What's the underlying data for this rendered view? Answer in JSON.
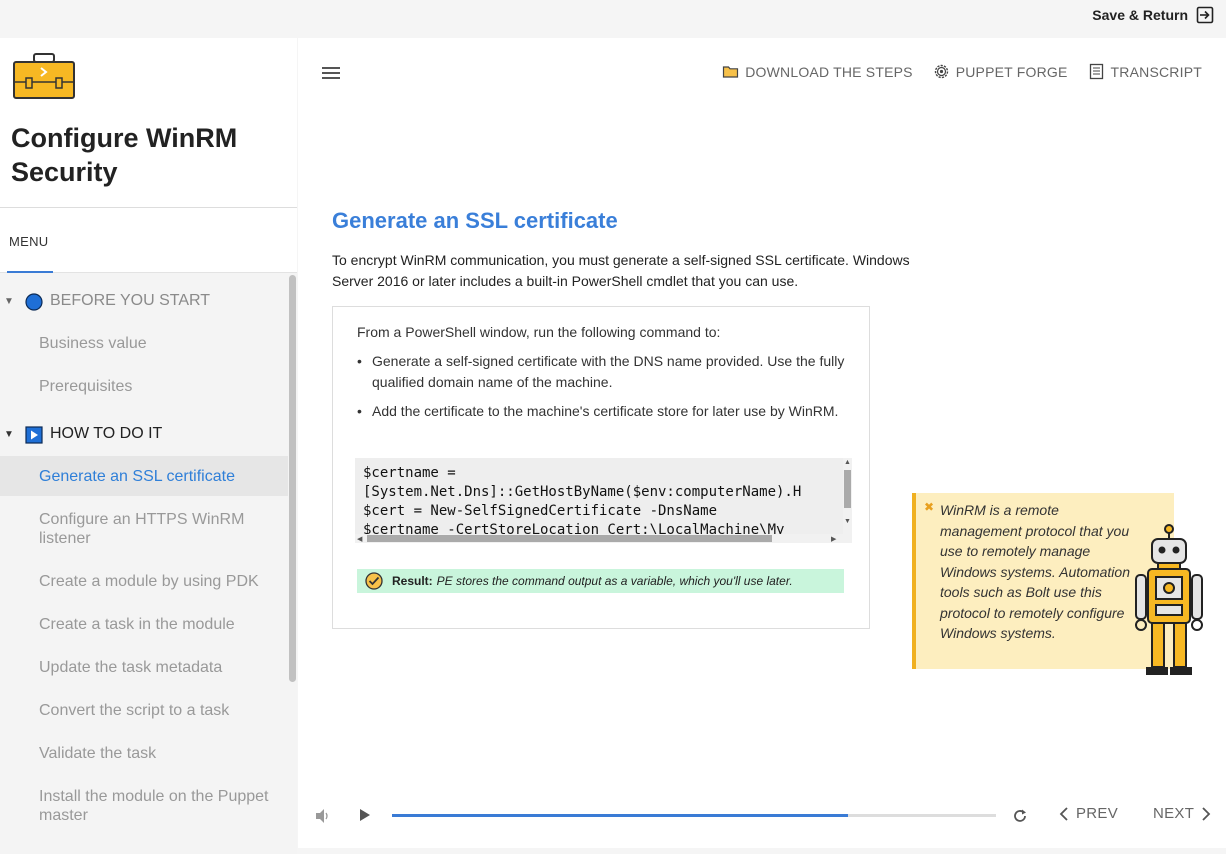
{
  "topbar": {
    "save_return": "Save & Return"
  },
  "sidebar": {
    "course_title": "Configure WinRM Security",
    "menu_label": "MENU",
    "sections": [
      {
        "label": "BEFORE YOU START",
        "icon": "circle-icon",
        "items": [
          "Business value",
          "Prerequisites"
        ]
      },
      {
        "label": "HOW TO DO IT",
        "icon": "play-square-icon",
        "items": [
          "Generate an SSL certificate",
          "Configure an HTTPS WinRM listener",
          "Create a module by using PDK",
          "Create a task in the module",
          "Update the task metadata",
          "Convert the script to a task",
          "Validate the task",
          "Install the module on the Puppet master"
        ]
      }
    ],
    "active_item": "Generate an SSL certificate"
  },
  "toolbar": {
    "download": "DOWNLOAD THE STEPS",
    "forge": "PUPPET FORGE",
    "transcript": "TRANSCRIPT"
  },
  "slide": {
    "title": "Generate an SSL certificate",
    "intro": "To encrypt WinRM communication, you must generate a self-signed SSL certificate. Windows Server 2016 or later includes a built-in PowerShell cmdlet that you can use.",
    "card_lead": "From a PowerShell window, run the following command to:",
    "bullets": [
      "Generate a self-signed certificate with the DNS name provided. Use the fully qualified domain name of the machine.",
      "Add the certificate to the machine's certificate store for later use by WinRM."
    ],
    "code_lines": [
      "$certname =",
      "[System.Net.Dns]::GetHostByName($env:computerName).H",
      "$cert = New-SelfSignedCertificate -DnsName",
      "$certname -CertStoreLocation Cert:\\LocalMachine\\My"
    ],
    "result_label": "Result:",
    "result_text": "PE stores the command output as a variable, which you'll use later.",
    "callout_text": "WinRM is a remote management protocol that you use to remotely manage Windows systems. Automation tools such as Bolt use this protocol to remotely configure Windows systems."
  },
  "player": {
    "progress": 0.755,
    "prev": "PREV",
    "next": "NEXT"
  },
  "colors": {
    "accent": "#3a7bd5",
    "callout_bg": "#fdeebf",
    "result_bg": "#c9f5dc"
  }
}
